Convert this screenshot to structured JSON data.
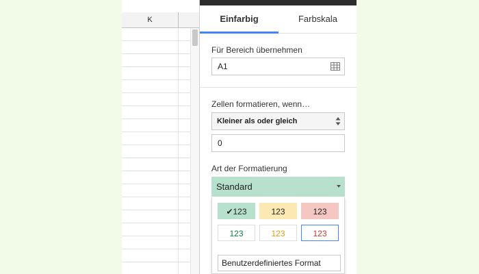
{
  "sheet": {
    "column_label": "K"
  },
  "panel": {
    "tabs": [
      {
        "label": "Einfarbig",
        "active": true
      },
      {
        "label": "Farbskala",
        "active": false
      }
    ],
    "range_label": "Für Bereich übernehmen",
    "range_value": "A1",
    "condition_label": "Zellen formatieren, wenn…",
    "condition_value": "Kleiner als oder gleich",
    "value_input": "0",
    "format_label": "Art der Formatierung",
    "format_selected": "Standard",
    "swatches": [
      {
        "text": "✔123",
        "bg": "#b7e1cd",
        "fg": "#222222",
        "border": "#b7e1cd"
      },
      {
        "text": "123",
        "bg": "#fce8b2",
        "fg": "#222222",
        "border": "#fce8b2"
      },
      {
        "text": "123",
        "bg": "#f4c7c3",
        "fg": "#222222",
        "border": "#f4c7c3"
      },
      {
        "text": "123",
        "bg": "#ffffff",
        "fg": "#0b8043",
        "border": "#dddddd"
      },
      {
        "text": "123",
        "bg": "#ffffff",
        "fg": "#e69a00",
        "border": "#dddddd"
      },
      {
        "text": "123",
        "bg": "#ffffff",
        "fg": "#c53929",
        "border": "#4285f4"
      }
    ],
    "custom_format": "Benutzerdefiniertes Format"
  },
  "colors": {
    "accent": "#4285f4",
    "background": "#f1fbe7",
    "selected_style": "#b7e1cd"
  }
}
